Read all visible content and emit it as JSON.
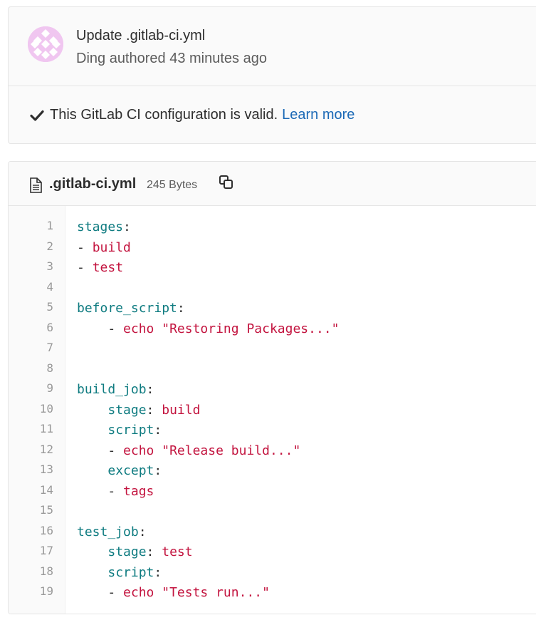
{
  "commit": {
    "title": "Update .gitlab-ci.yml",
    "meta": "Ding authored 43 minutes ago",
    "ci_status_text": "This GitLab CI configuration is valid.",
    "learn_more_label": "Learn more",
    "avatar_icon": "identicon-avatar",
    "check_icon": "check-icon"
  },
  "file": {
    "name": ".gitlab-ci.yml",
    "size": "245 Bytes",
    "icon": "file-text-icon",
    "copy_icon": "copy-icon"
  },
  "colors": {
    "key": "#0e7b80",
    "value": "#c3143f",
    "link": "#1b69b6",
    "avatar": "#f0c6f0"
  },
  "code_lines": [
    {
      "num": "1",
      "indent": "",
      "key": "stages",
      "sep": ":",
      "dash": "",
      "val": ""
    },
    {
      "num": "2",
      "indent": "",
      "key": "",
      "sep": "",
      "dash": "- ",
      "val": "build"
    },
    {
      "num": "3",
      "indent": "",
      "key": "",
      "sep": "",
      "dash": "- ",
      "val": "test"
    },
    {
      "num": "4",
      "indent": "",
      "key": "",
      "sep": "",
      "dash": "",
      "val": ""
    },
    {
      "num": "5",
      "indent": "",
      "key": "before_script",
      "sep": ":",
      "dash": "",
      "val": ""
    },
    {
      "num": "6",
      "indent": "    ",
      "key": "",
      "sep": "",
      "dash": "- ",
      "val": "echo \"Restoring Packages...\""
    },
    {
      "num": "7",
      "indent": "",
      "key": "",
      "sep": "",
      "dash": "",
      "val": ""
    },
    {
      "num": "8",
      "indent": "",
      "key": "",
      "sep": "",
      "dash": "",
      "val": ""
    },
    {
      "num": "9",
      "indent": "",
      "key": "build_job",
      "sep": ":",
      "dash": "",
      "val": ""
    },
    {
      "num": "10",
      "indent": "    ",
      "key": "stage",
      "sep": ": ",
      "dash": "",
      "val": "build"
    },
    {
      "num": "11",
      "indent": "    ",
      "key": "script",
      "sep": ":",
      "dash": "",
      "val": ""
    },
    {
      "num": "12",
      "indent": "    ",
      "key": "",
      "sep": "",
      "dash": "- ",
      "val": "echo \"Release build...\""
    },
    {
      "num": "13",
      "indent": "    ",
      "key": "except",
      "sep": ":",
      "dash": "",
      "val": ""
    },
    {
      "num": "14",
      "indent": "    ",
      "key": "",
      "sep": "",
      "dash": "- ",
      "val": "tags"
    },
    {
      "num": "15",
      "indent": "",
      "key": "",
      "sep": "",
      "dash": "",
      "val": ""
    },
    {
      "num": "16",
      "indent": "",
      "key": "test_job",
      "sep": ":",
      "dash": "",
      "val": ""
    },
    {
      "num": "17",
      "indent": "    ",
      "key": "stage",
      "sep": ": ",
      "dash": "",
      "val": "test"
    },
    {
      "num": "18",
      "indent": "    ",
      "key": "script",
      "sep": ":",
      "dash": "",
      "val": ""
    },
    {
      "num": "19",
      "indent": "    ",
      "key": "",
      "sep": "",
      "dash": "- ",
      "val": "echo \"Tests run...\""
    }
  ]
}
